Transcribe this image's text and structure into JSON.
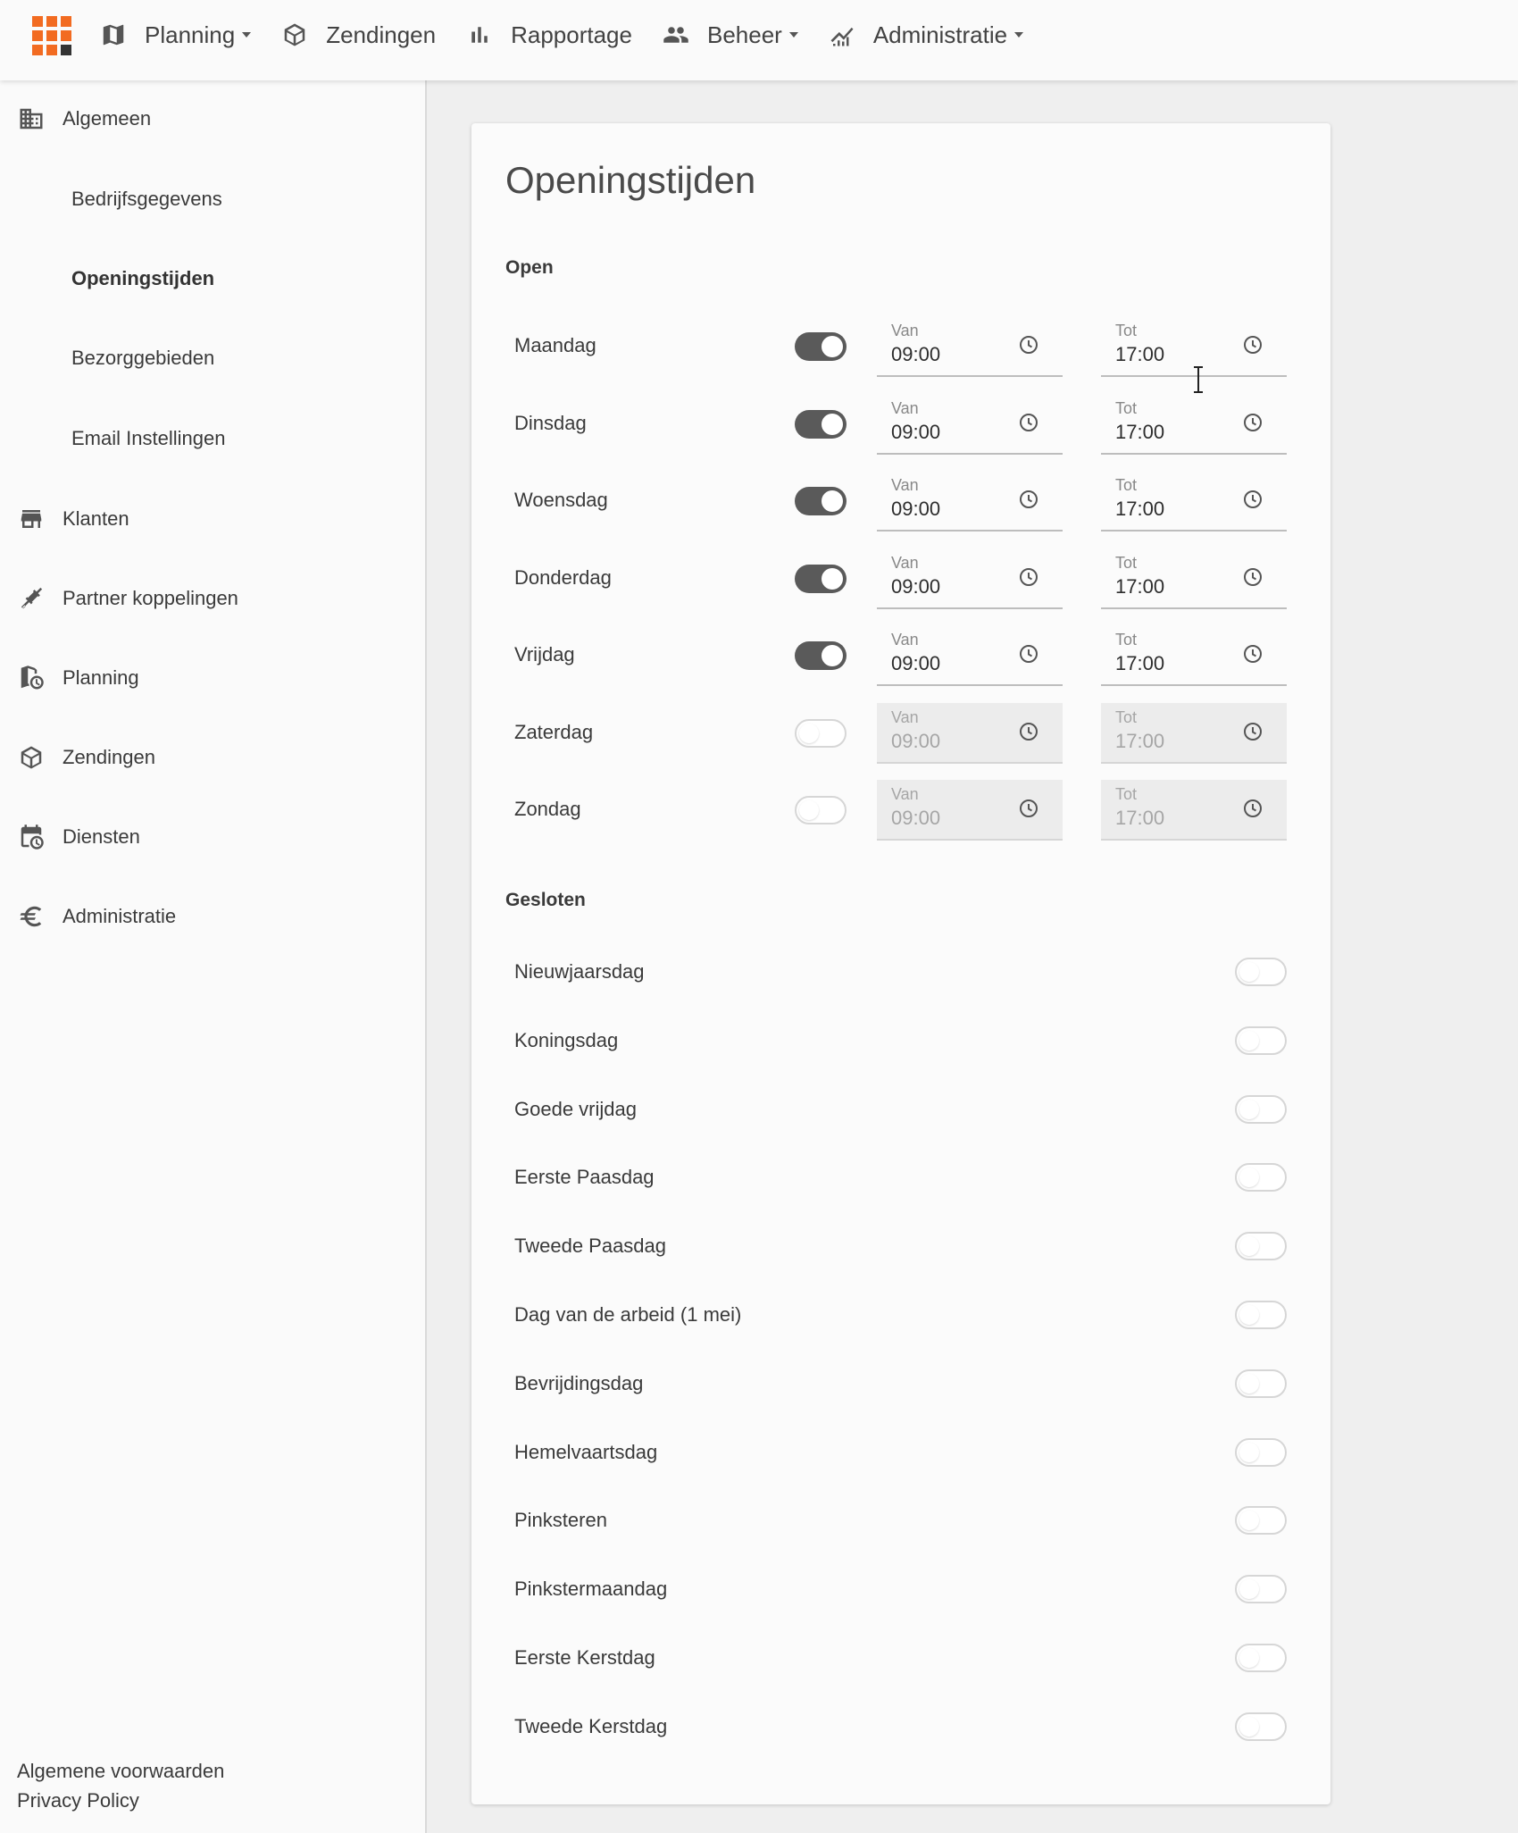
{
  "nav": {
    "items": [
      {
        "label": "Planning",
        "icon": "map-icon",
        "dropdown": true
      },
      {
        "label": "Zendingen",
        "icon": "package-icon",
        "dropdown": false
      },
      {
        "label": "Rapportage",
        "icon": "bar-chart-icon",
        "dropdown": false
      },
      {
        "label": "Beheer",
        "icon": "people-icon",
        "dropdown": true
      },
      {
        "label": "Administratie",
        "icon": "finance-chart-icon",
        "dropdown": true
      }
    ]
  },
  "sidebar": {
    "algemeen": "Algemeen",
    "sub": [
      "Bedrijfsgegevens",
      "Openingstijden",
      "Bezorggebieden",
      "Email Instellingen"
    ],
    "klanten": "Klanten",
    "partner": "Partner koppelingen",
    "planning": "Planning",
    "zendingen": "Zendingen",
    "diensten": "Diensten",
    "administratie": "Administratie",
    "footer": [
      "Algemene voorwaarden",
      "Privacy Policy"
    ]
  },
  "page": {
    "title": "Openingstijden",
    "open_heading": "Open",
    "closed_heading": "Gesloten",
    "from_label": "Van",
    "to_label": "Tot"
  },
  "days": [
    {
      "name": "Maandag",
      "open": true,
      "from": "09:00",
      "to": "17:00"
    },
    {
      "name": "Dinsdag",
      "open": true,
      "from": "09:00",
      "to": "17:00"
    },
    {
      "name": "Woensdag",
      "open": true,
      "from": "09:00",
      "to": "17:00"
    },
    {
      "name": "Donderdag",
      "open": true,
      "from": "09:00",
      "to": "17:00"
    },
    {
      "name": "Vrijdag",
      "open": true,
      "from": "09:00",
      "to": "17:00"
    },
    {
      "name": "Zaterdag",
      "open": false,
      "from": "09:00",
      "to": "17:00"
    },
    {
      "name": "Zondag",
      "open": false,
      "from": "09:00",
      "to": "17:00"
    }
  ],
  "holidays": [
    {
      "name": "Nieuwjaarsdag",
      "closed": false
    },
    {
      "name": "Koningsdag",
      "closed": false
    },
    {
      "name": "Goede vrijdag",
      "closed": false
    },
    {
      "name": "Eerste Paasdag",
      "closed": false
    },
    {
      "name": "Tweede Paasdag",
      "closed": false
    },
    {
      "name": "Dag van de arbeid (1 mei)",
      "closed": false
    },
    {
      "name": "Bevrijdingsdag",
      "closed": false
    },
    {
      "name": "Hemelvaartsdag",
      "closed": false
    },
    {
      "name": "Pinksteren",
      "closed": false
    },
    {
      "name": "Pinkstermaandag",
      "closed": false
    },
    {
      "name": "Eerste Kerstdag",
      "closed": false
    },
    {
      "name": "Tweede Kerstdag",
      "closed": false
    }
  ],
  "colors": {
    "brand": "#f26b21",
    "toggle_on": "#5a5a5a",
    "background": "#efefef"
  }
}
